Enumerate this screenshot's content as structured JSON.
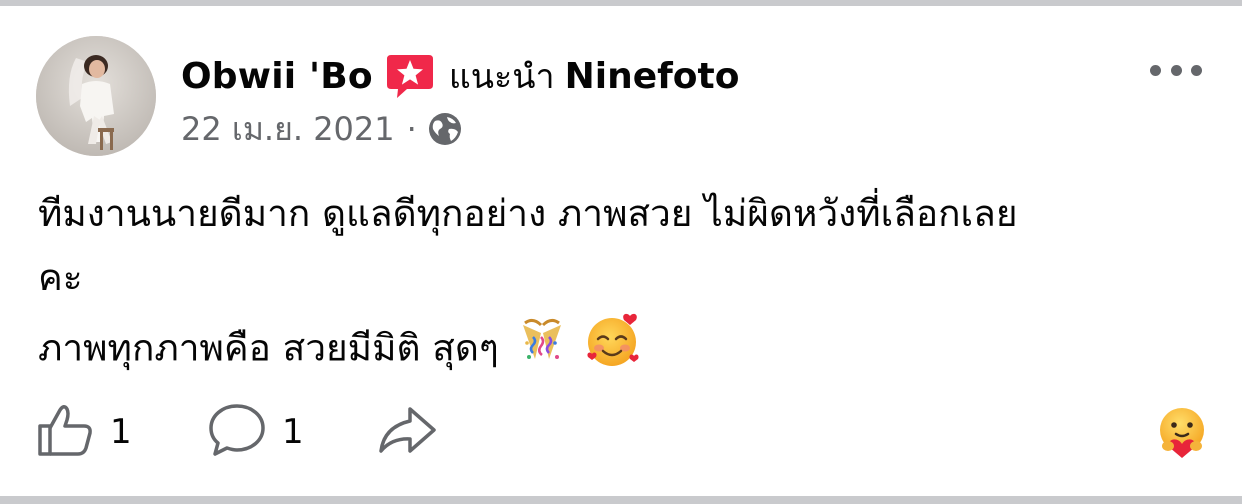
{
  "post": {
    "author_name": "Obwii 'Bo",
    "recommends_text": "แนะนำ",
    "page_name": "Ninefoto",
    "date": "22 เม.ย. 2021",
    "separator": "·",
    "privacy_icon": "globe-icon",
    "badge_icon": "recommendation-star-icon",
    "body_lines": [
      "ทีมงานนายดีมาก ดูแลดีทุกอย่าง ภาพสวย ไม่ผิดหวังที่เลือกเลย",
      "คะ",
      "ภาพทุกภาพคือ สวยมีมิติ สุดๆ"
    ],
    "body_emojis": [
      "party-popper-icon",
      "smiling-face-with-hearts-icon"
    ]
  },
  "actions": {
    "like_count": "1",
    "comment_count": "1",
    "share_icon": "share-icon",
    "reaction_icon": "care-reaction-icon"
  },
  "colors": {
    "badge_red": "#f0284a",
    "meta_gray": "#65676b",
    "frame_gray": "#c9cacd",
    "text": "#050505"
  }
}
